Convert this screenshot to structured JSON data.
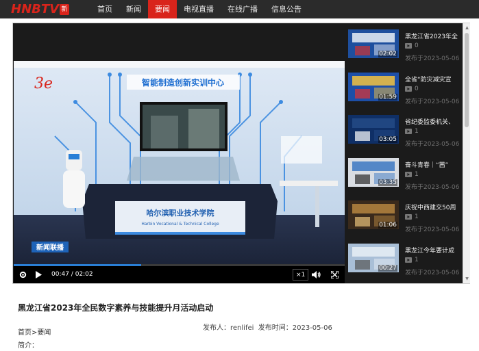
{
  "header": {
    "logo_text": "HNBTV",
    "logo_badge": "新",
    "nav": [
      {
        "label": "首页",
        "active": false
      },
      {
        "label": "新闻",
        "active": false
      },
      {
        "label": "要闻",
        "active": true
      },
      {
        "label": "电视直播",
        "active": false
      },
      {
        "label": "在线广播",
        "active": false
      },
      {
        "label": "信息公告",
        "active": false
      }
    ]
  },
  "player": {
    "current_time": "00:47",
    "duration": "02:02",
    "time_display": "00:47 / 02:02",
    "progress": 0.385,
    "speed": "×1",
    "video_caption": "智能制造创新实训中心",
    "school_name": "哈尔滨职业技术学院",
    "school_name_en": "Harbin Vocational & Technical College",
    "news_badge": "新闻联播",
    "accent": "#2a7fd6"
  },
  "playlist": [
    {
      "title": "黑龙江省2023年全",
      "duration": "02:02",
      "views": "0",
      "date": "发布于2023-05-06"
    },
    {
      "title": "全省“防灾减灾宣",
      "duration": "01:59",
      "views": "0",
      "date": "发布于2023-05-06"
    },
    {
      "title": "省纪委监委机关、",
      "duration": "03:05",
      "views": "1",
      "date": "发布于2023-05-06"
    },
    {
      "title": "奋斗青春｜“茜”",
      "duration": "03:35",
      "views": "1",
      "date": "发布于2023-05-06"
    },
    {
      "title": "庆祝中西建交50周",
      "duration": "01:06",
      "views": "1",
      "date": "发布于2023-05-06"
    },
    {
      "title": "黑龙江今年要计成",
      "duration": "00:27",
      "views": "1",
      "date": "发布于2023-05-06"
    }
  ],
  "article": {
    "title": "黑龙江省2023年全民数字素养与技能提升月活动启动",
    "author_label": "发布人：",
    "author": "renlifei",
    "time_label": "发布时间：",
    "publish_time": "2023-05-06",
    "breadcrumb": "首页>要闻",
    "summary_label": "简介："
  },
  "colors": {
    "brand_red": "#d9241b",
    "topbar_bg": "#2b2b2b",
    "player_bg": "#1b1b1b"
  }
}
